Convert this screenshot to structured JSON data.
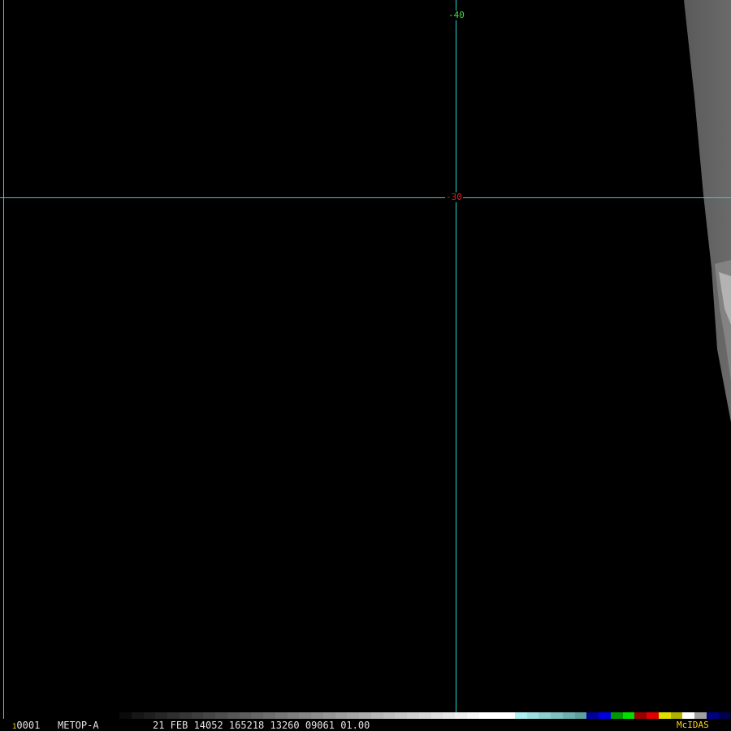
{
  "map": {
    "grid_lines": [
      {
        "orientation": "meridian",
        "color": "#1fd6d6"
      },
      {
        "orientation": "meridian",
        "color": "#1fd6d6"
      },
      {
        "orientation": "parallel",
        "color": "#1fd6d6"
      }
    ],
    "labels": [
      {
        "text": "-40",
        "color": "#3fe03f"
      },
      {
        "text": "-30",
        "color": "#e02020"
      }
    ]
  },
  "status_bar": {
    "frame_loop_marker": "1",
    "frame_number": "0001",
    "satellite": "METOP-A",
    "info": "21 FEB 14052 165218 13260 09061 01.00",
    "brand": "McIDAS",
    "brand_color": "#ffd21e"
  },
  "color_bar": {
    "colors": [
      "#0a0a0a",
      "#161616",
      "#1e1e1e",
      "#262626",
      "#2e2e2e",
      "#363636",
      "#3e3e3e",
      "#464646",
      "#4e4e4e",
      "#565656",
      "#5e5e5e",
      "#666666",
      "#6e6e6e",
      "#767676",
      "#7e7e7e",
      "#868686",
      "#8e8e8e",
      "#969696",
      "#9e9e9e",
      "#a6a6a6",
      "#aeaeae",
      "#b6b6b6",
      "#bebebe",
      "#c6c6c6",
      "#cecece",
      "#d6d6d6",
      "#dedede",
      "#e6e6e6",
      "#eeeeee",
      "#f6f6f6",
      "#ffffff",
      "#ffffff",
      "#ffffff",
      "#aef0f0",
      "#9ee0e0",
      "#8ecfcf",
      "#7ebfbf",
      "#6eafaf",
      "#5e9f9f",
      "#00009a",
      "#0000e0",
      "#009a00",
      "#00e000",
      "#9a0000",
      "#e00000",
      "#e0e000",
      "#b0b000",
      "#ffffff",
      "#a0a0a0",
      "#000080",
      "#000050"
    ]
  }
}
